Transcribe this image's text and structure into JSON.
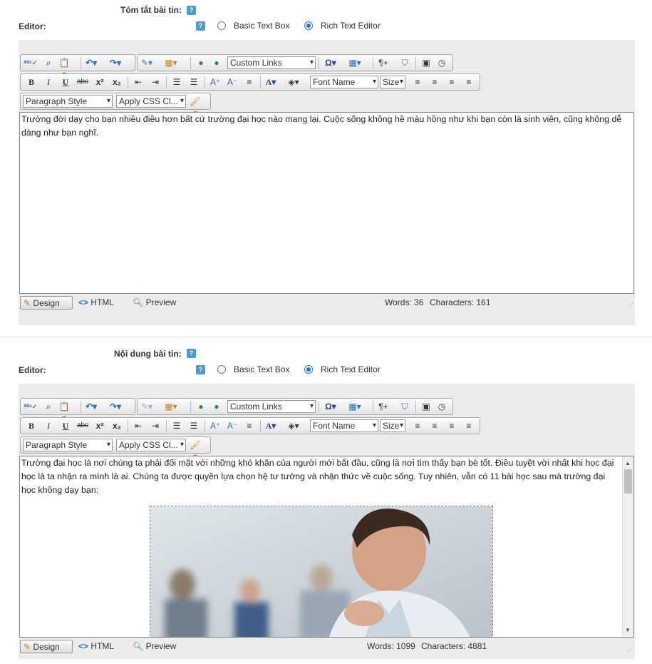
{
  "section1": {
    "field_label": "Tóm tắt bài tin:",
    "editor_label": "Editor:",
    "radio_basic": "Basic Text Box",
    "radio_rich": "Rich Text Editor",
    "selected_mode": "Rich Text Editor",
    "toolbar": {
      "custom_links": "Custom Links",
      "font_name": "Font Name",
      "size": "Size",
      "paragraph_style": "Paragraph Style",
      "apply_css": "Apply CSS Cl..."
    },
    "content": "Trường đời dạy cho bạn nhiều điều hơn bất cứ trường đại học nào mang lại. Cuộc sống không hề màu hồng như khi bạn còn là sinh viên, cũng không dễ dàng như bạn nghĩ.",
    "mode_tabs": [
      "Design",
      "HTML",
      "Preview"
    ],
    "words": "Words: 36",
    "characters": "Characters: 161"
  },
  "section2": {
    "field_label": "Nội dung bài tin:",
    "editor_label": "Editor:",
    "radio_basic": "Basic Text Box",
    "radio_rich": "Rich Text Editor",
    "selected_mode": "Rich Text Editor",
    "toolbar": {
      "custom_links": "Custom Links",
      "font_name": "Font Name",
      "size": "Size",
      "paragraph_style": "Paragraph Style",
      "apply_css": "Apply CSS Cl..."
    },
    "content": "Trường đại học là nơi chúng ta phải đối mặt với những khó khăn của người mới bắt đầu, cũng là nơi tìm thấy bạn bè tốt. Điều tuyệt vời nhất khi học đại học là ta nhận ra mình là ai. Chúng ta được quyền lựa chọn hệ tư tưởng và nhận thức về cuộc sống. Tuy nhiên, vẫn có 11 bài học sau mà trường đại học không dạy bạn:",
    "mode_tabs": [
      "Design",
      "HTML",
      "Preview"
    ],
    "words": "Words: 1099",
    "characters": "Characters: 4881"
  },
  "colors": {
    "accent": "#1a73e8",
    "panel": "#ececec",
    "help": "#4a9ad8"
  },
  "icons": [
    "spellcheck-icon",
    "find-icon",
    "paste-icon",
    "undo-icon",
    "redo-icon",
    "format-brush-icon",
    "image-manager-icon",
    "link-icon",
    "unlink-icon",
    "symbol-icon",
    "table-icon",
    "paragraph-icon",
    "hyperlink-manager-icon",
    "template-icon",
    "clock-icon",
    "bold-icon",
    "italic-icon",
    "underline-icon",
    "strikethrough-icon",
    "superscript-icon",
    "subscript-icon",
    "indent-icon",
    "outdent-icon",
    "ordered-list-icon",
    "unordered-list-icon",
    "font-color-icon",
    "highlight-icon",
    "align-left-icon",
    "align-center-icon",
    "align-right-icon",
    "justify-icon",
    "design-pencil-icon",
    "html-code-icon",
    "preview-magnifier-icon"
  ]
}
